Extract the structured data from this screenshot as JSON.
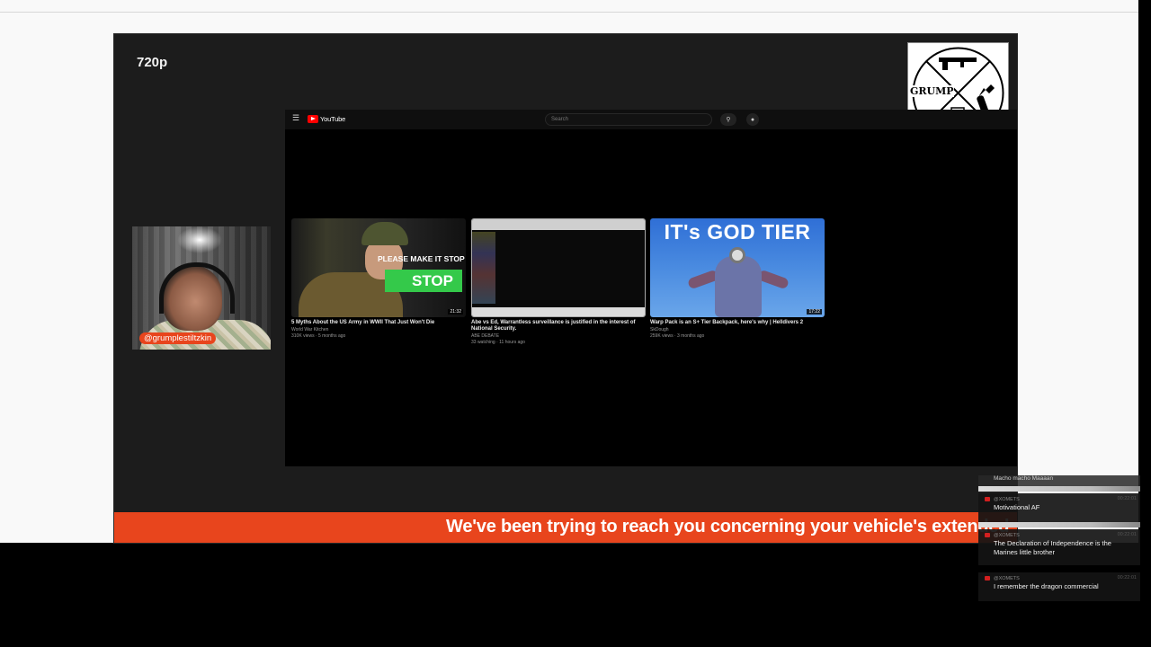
{
  "stream": {
    "quality": "720p",
    "username_tag": "@grumplestiltzkin",
    "logo_text": "GRUMP"
  },
  "youtube": {
    "menu_icon": "hamburger-icon",
    "logo_text": "YouTube",
    "search_placeholder": "Search",
    "videos": [
      {
        "title": "5 Myths About the US Army in WWII That Just Won't Die",
        "channel": "World War Kitchen",
        "meta": "310K views · 5 months ago",
        "duration": "21:32",
        "thumb_caption": "PLEASE MAKE IT STOP",
        "thumb_highlight": "STOP"
      },
      {
        "title": "Abe vs Ed, Warrantless surveillance is justified in the interest of National Security.",
        "channel": "ABE DEBATE",
        "meta": "33 watching · 11 hours ago",
        "duration": ""
      },
      {
        "title": "Warp Pack is an S+ Tier Backpack, here's why | Helldivers 2",
        "channel": "SkDough",
        "meta": "259K views · 3 months ago",
        "duration": "17:22",
        "thumb_caption": "IT's GOD TIER"
      }
    ]
  },
  "ticker": {
    "text": "We've been trying to reach you concerning your vehicle's extended"
  },
  "chat": {
    "header_text": "Macho macho Maaaan",
    "messages": [
      {
        "user": "@XOMETS",
        "time": "00:22:01",
        "text": "Motivational AF"
      },
      {
        "user": "@XOMETS",
        "time": "00:22:01",
        "text": "The Declaration of Independence is the Marines little brother"
      },
      {
        "user": "@XOMETS",
        "time": "00:22:01",
        "text": "I remember the dragon commercial"
      }
    ]
  },
  "colors": {
    "accent": "#e8451d",
    "player_bg": "#1c1c1c",
    "page_bg": "#f9f9f9",
    "youtube_red": "#ff0000"
  }
}
